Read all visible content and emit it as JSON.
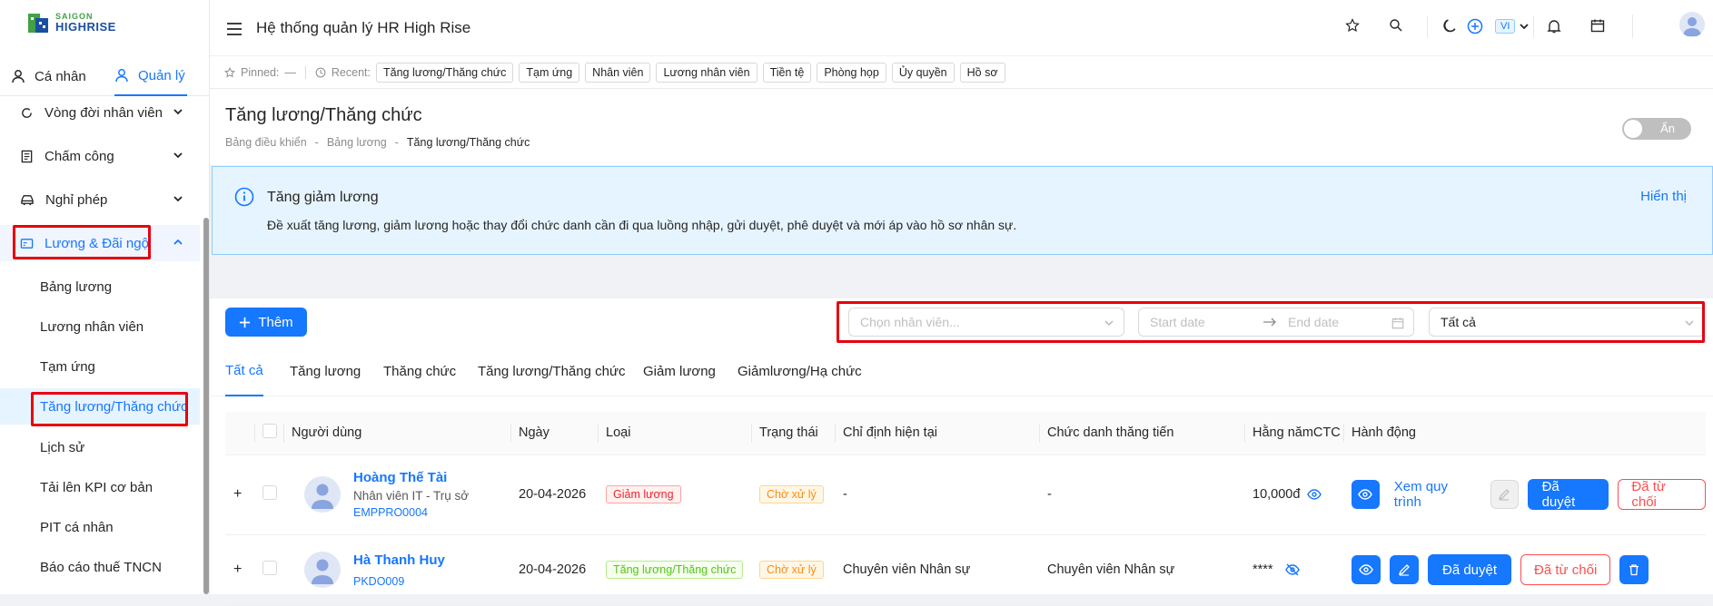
{
  "app": {
    "title": "Hệ thống quản lý HR High Rise",
    "logo_line1": "SAIGON",
    "logo_line2": "HIGHRISE",
    "language": "VI"
  },
  "sidebar": {
    "mode_tabs": [
      {
        "label": "Cá nhân",
        "active": false
      },
      {
        "label": "Quản lý",
        "active": true
      }
    ],
    "groups": [
      {
        "label": "Vòng đời nhân viên"
      },
      {
        "label": "Chấm công"
      },
      {
        "label": "Nghỉ phép"
      },
      {
        "label": "Lương & Đãi ngộ",
        "expanded": true
      }
    ],
    "sub_items": [
      {
        "label": "Bảng lương"
      },
      {
        "label": "Lương nhân viên"
      },
      {
        "label": "Tạm ứng"
      },
      {
        "label": "Tăng lương/Thăng chức",
        "active": true
      },
      {
        "label": "Lịch sử"
      },
      {
        "label": "Tải lên KPI cơ bản"
      },
      {
        "label": "PIT cá nhân"
      },
      {
        "label": "Báo cáo thuế TNCN"
      }
    ]
  },
  "recent": {
    "pinned_label": "Pinned:",
    "pinned_value": "—",
    "recent_label": "Recent:",
    "items": [
      "Tăng lương/Thăng chức",
      "Tạm ứng",
      "Nhân viên",
      "Lương nhân viên",
      "Tiền tệ",
      "Phòng họp",
      "Ủy quyền",
      "Hồ sơ"
    ]
  },
  "page": {
    "title": "Tăng lương/Thăng chức",
    "breadcrumb": [
      "Bảng điều khiển",
      "Bảng lương",
      "Tăng lương/Thăng chức"
    ],
    "toggle_label": "Ẩn"
  },
  "alert": {
    "title": "Tăng giảm lương",
    "description": "Đề xuất tăng lương, giảm lương hoặc thay đổi chức danh cần đi qua luồng nhập, gửi duyệt, phê duyệt và mới áp vào hồ sơ nhân sự.",
    "link": "Hiển thị"
  },
  "toolbar": {
    "add_label": "Thêm",
    "employee_placeholder": "Chọn nhân viên...",
    "start_placeholder": "Start date",
    "end_placeholder": "End date",
    "status_value": "Tất cả"
  },
  "tabs": [
    {
      "label": "Tất cả",
      "active": true
    },
    {
      "label": "Tăng lương"
    },
    {
      "label": "Thăng chức"
    },
    {
      "label": "Tăng lương/Thăng chức"
    },
    {
      "label": "Giảm lương"
    },
    {
      "label": "Giảmlương/Hạ chức"
    }
  ],
  "table": {
    "columns": [
      "Người dùng",
      "Ngày",
      "Loại",
      "Trạng thái",
      "Chỉ định hiện tại",
      "Chức danh thăng tiến",
      "Hằng nămCTC",
      "Hành động"
    ],
    "rows": [
      {
        "name": "Hoàng Thế Tài",
        "position": "Nhân viên IT - Trụ sở",
        "code": "EMPPRO0004",
        "date": "20-04-2026",
        "type": "Giảm lương",
        "status": "Chờ xử lý",
        "current": "-",
        "promoted": "-",
        "ctc": "10,000đ",
        "view_flow": "Xem quy trình",
        "approve": "Đã duyệt",
        "reject": "Đã từ chối"
      },
      {
        "name": "Hà Thanh Huy",
        "position": "",
        "code": "PKDO009",
        "date": "20-04-2026",
        "type": "Tăng lương/Thăng chức",
        "status": "Chờ xử lý",
        "current": "Chuyên viên Nhân sự",
        "promoted": "Chuyên viên Nhân sự",
        "ctc": "****",
        "approve": "Đã duyệt",
        "reject": "Đã từ chối"
      }
    ]
  },
  "colors": {
    "primary": "#1677ff",
    "danger": "#ff4d4f",
    "highlight_box": "#e8000f"
  }
}
